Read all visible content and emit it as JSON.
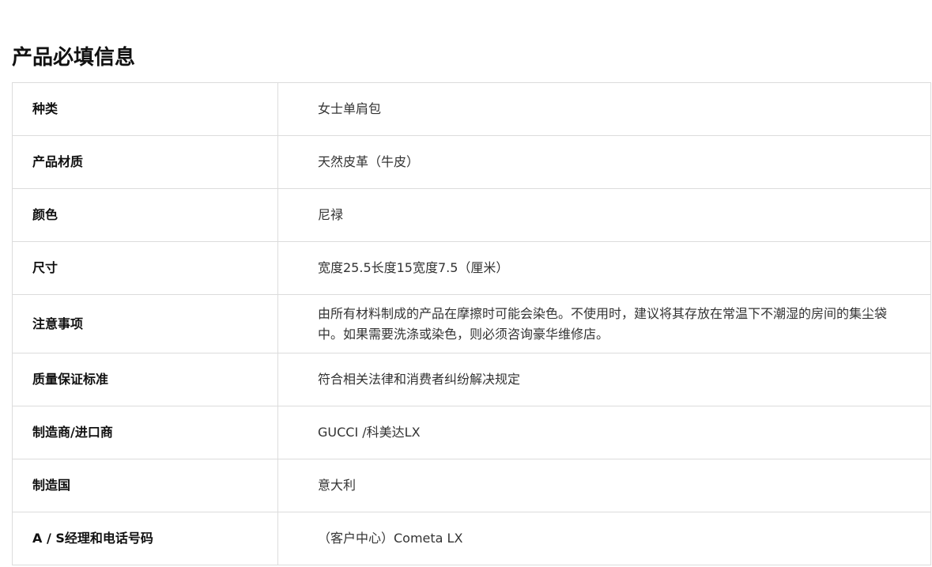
{
  "section": {
    "title": "产品必填信息"
  },
  "rows": [
    {
      "label": "种类",
      "value": "女士单肩包"
    },
    {
      "label": "产品材质",
      "value": "天然皮革（牛皮）"
    },
    {
      "label": "颜色",
      "value": "尼禄"
    },
    {
      "label": "尺寸",
      "value": "宽度25.5长度15宽度7.5（厘米）"
    },
    {
      "label": "注意事项",
      "value": "由所有材料制成的产品在摩擦时可能会染色。不使用时，建议将其存放在常温下不潮湿的房间的集尘袋中。如果需要洗涤或染色，则必须咨询豪华维修店。"
    },
    {
      "label": "质量保证标准",
      "value": "符合相关法律和消费者纠纷解决规定"
    },
    {
      "label": "制造商/进口商",
      "value": "GUCCI /科美达LX"
    },
    {
      "label": "制造国",
      "value": "意大利"
    },
    {
      "label": "A / S经理和电话号码",
      "value": "（客户中心）Cometa LX"
    }
  ]
}
